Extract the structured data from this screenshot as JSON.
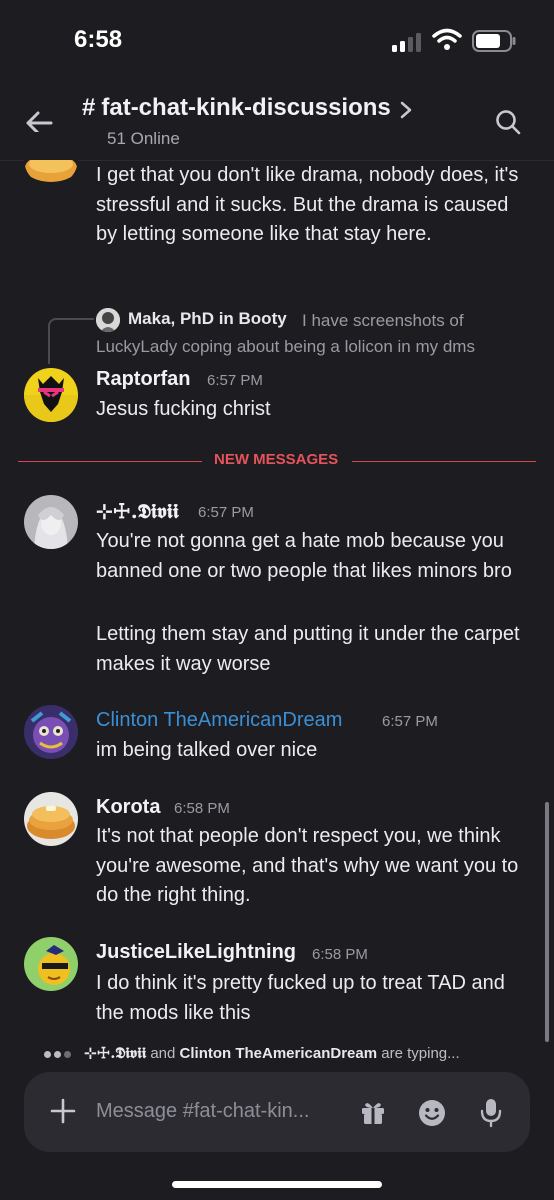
{
  "status_bar": {
    "time": "6:58"
  },
  "header": {
    "hash": "#",
    "channel_name": "fat-chat-kink-discussions",
    "online_count": "51 Online"
  },
  "messages": [
    {
      "continuation": true,
      "text": "I get that you don't like drama, nobody does, it's stressful and it sucks. But the drama is caused by letting someone like that stay here."
    },
    {
      "reply": {
        "author": "Maka, PhD in Booty",
        "text": "I have screenshots of LuckyLady coping about being a lolicon in my dms"
      },
      "author": "Raptorfan",
      "time": "6:57 PM",
      "text": "Jesus fucking christ"
    },
    {
      "author": "⊹☩.𝕯𝖎𝖛𝖎𝖎",
      "time": "6:57 PM",
      "text": "You're not gonna get a hate mob because you banned one or two people that likes minors bro",
      "text2": "Letting them stay and putting it under the carpet makes it way worse"
    },
    {
      "author": "Clinton TheAmericanDream",
      "author_color": "#3b8fd4",
      "time": "6:57 PM",
      "text": "im being talked over nice"
    },
    {
      "author": "Korota",
      "time": "6:58 PM",
      "text": "It's not that people don't respect you, we think you're awesome, and that's why we want you to do the right thing."
    },
    {
      "author": "JusticeLikeLightning",
      "time": "6:58 PM",
      "text": "I do think it's pretty fucked up to treat TAD and the mods like this"
    }
  ],
  "new_messages_label": "NEW MESSAGES",
  "typing": {
    "user1": "⊹☩.𝕯𝖎𝖛𝖎𝖎",
    "conj": "and",
    "user2": "Clinton TheAmericanDream",
    "suffix": "are typing..."
  },
  "composer": {
    "placeholder": "Message #fat-chat-kin..."
  },
  "colors": {
    "accent_red": "#e5535c",
    "online_green": "#23a55a",
    "link_blue": "#3b8fd4"
  },
  "icons": [
    "back-arrow-icon",
    "chevron-right-icon",
    "search-icon",
    "plus-icon",
    "gift-icon",
    "emoji-icon",
    "mic-icon"
  ]
}
